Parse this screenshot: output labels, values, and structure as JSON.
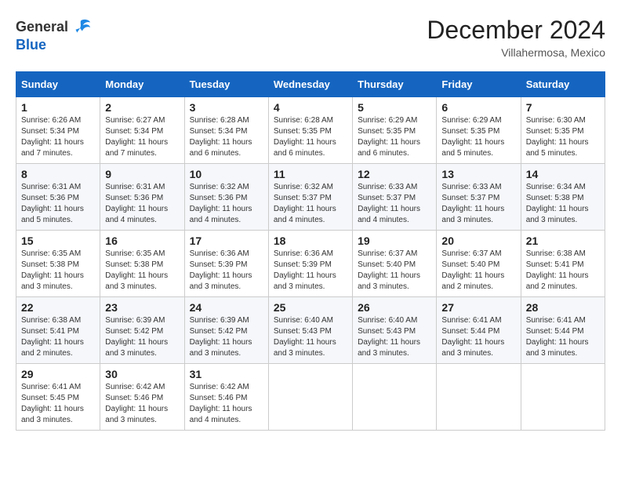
{
  "header": {
    "logo_general": "General",
    "logo_blue": "Blue",
    "month_title": "December 2024",
    "subtitle": "Villahermosa, Mexico"
  },
  "calendar": {
    "days_of_week": [
      "Sunday",
      "Monday",
      "Tuesday",
      "Wednesday",
      "Thursday",
      "Friday",
      "Saturday"
    ],
    "weeks": [
      [
        {
          "day": "1",
          "sunrise": "6:26 AM",
          "sunset": "5:34 PM",
          "daylight": "11 hours and 7 minutes."
        },
        {
          "day": "2",
          "sunrise": "6:27 AM",
          "sunset": "5:34 PM",
          "daylight": "11 hours and 7 minutes."
        },
        {
          "day": "3",
          "sunrise": "6:28 AM",
          "sunset": "5:34 PM",
          "daylight": "11 hours and 6 minutes."
        },
        {
          "day": "4",
          "sunrise": "6:28 AM",
          "sunset": "5:35 PM",
          "daylight": "11 hours and 6 minutes."
        },
        {
          "day": "5",
          "sunrise": "6:29 AM",
          "sunset": "5:35 PM",
          "daylight": "11 hours and 6 minutes."
        },
        {
          "day": "6",
          "sunrise": "6:29 AM",
          "sunset": "5:35 PM",
          "daylight": "11 hours and 5 minutes."
        },
        {
          "day": "7",
          "sunrise": "6:30 AM",
          "sunset": "5:35 PM",
          "daylight": "11 hours and 5 minutes."
        }
      ],
      [
        {
          "day": "8",
          "sunrise": "6:31 AM",
          "sunset": "5:36 PM",
          "daylight": "11 hours and 5 minutes."
        },
        {
          "day": "9",
          "sunrise": "6:31 AM",
          "sunset": "5:36 PM",
          "daylight": "11 hours and 4 minutes."
        },
        {
          "day": "10",
          "sunrise": "6:32 AM",
          "sunset": "5:36 PM",
          "daylight": "11 hours and 4 minutes."
        },
        {
          "day": "11",
          "sunrise": "6:32 AM",
          "sunset": "5:37 PM",
          "daylight": "11 hours and 4 minutes."
        },
        {
          "day": "12",
          "sunrise": "6:33 AM",
          "sunset": "5:37 PM",
          "daylight": "11 hours and 4 minutes."
        },
        {
          "day": "13",
          "sunrise": "6:33 AM",
          "sunset": "5:37 PM",
          "daylight": "11 hours and 3 minutes."
        },
        {
          "day": "14",
          "sunrise": "6:34 AM",
          "sunset": "5:38 PM",
          "daylight": "11 hours and 3 minutes."
        }
      ],
      [
        {
          "day": "15",
          "sunrise": "6:35 AM",
          "sunset": "5:38 PM",
          "daylight": "11 hours and 3 minutes."
        },
        {
          "day": "16",
          "sunrise": "6:35 AM",
          "sunset": "5:38 PM",
          "daylight": "11 hours and 3 minutes."
        },
        {
          "day": "17",
          "sunrise": "6:36 AM",
          "sunset": "5:39 PM",
          "daylight": "11 hours and 3 minutes."
        },
        {
          "day": "18",
          "sunrise": "6:36 AM",
          "sunset": "5:39 PM",
          "daylight": "11 hours and 3 minutes."
        },
        {
          "day": "19",
          "sunrise": "6:37 AM",
          "sunset": "5:40 PM",
          "daylight": "11 hours and 3 minutes."
        },
        {
          "day": "20",
          "sunrise": "6:37 AM",
          "sunset": "5:40 PM",
          "daylight": "11 hours and 2 minutes."
        },
        {
          "day": "21",
          "sunrise": "6:38 AM",
          "sunset": "5:41 PM",
          "daylight": "11 hours and 2 minutes."
        }
      ],
      [
        {
          "day": "22",
          "sunrise": "6:38 AM",
          "sunset": "5:41 PM",
          "daylight": "11 hours and 2 minutes."
        },
        {
          "day": "23",
          "sunrise": "6:39 AM",
          "sunset": "5:42 PM",
          "daylight": "11 hours and 3 minutes."
        },
        {
          "day": "24",
          "sunrise": "6:39 AM",
          "sunset": "5:42 PM",
          "daylight": "11 hours and 3 minutes."
        },
        {
          "day": "25",
          "sunrise": "6:40 AM",
          "sunset": "5:43 PM",
          "daylight": "11 hours and 3 minutes."
        },
        {
          "day": "26",
          "sunrise": "6:40 AM",
          "sunset": "5:43 PM",
          "daylight": "11 hours and 3 minutes."
        },
        {
          "day": "27",
          "sunrise": "6:41 AM",
          "sunset": "5:44 PM",
          "daylight": "11 hours and 3 minutes."
        },
        {
          "day": "28",
          "sunrise": "6:41 AM",
          "sunset": "5:44 PM",
          "daylight": "11 hours and 3 minutes."
        }
      ],
      [
        {
          "day": "29",
          "sunrise": "6:41 AM",
          "sunset": "5:45 PM",
          "daylight": "11 hours and 3 minutes."
        },
        {
          "day": "30",
          "sunrise": "6:42 AM",
          "sunset": "5:46 PM",
          "daylight": "11 hours and 3 minutes."
        },
        {
          "day": "31",
          "sunrise": "6:42 AM",
          "sunset": "5:46 PM",
          "daylight": "11 hours and 4 minutes."
        },
        null,
        null,
        null,
        null
      ]
    ]
  }
}
